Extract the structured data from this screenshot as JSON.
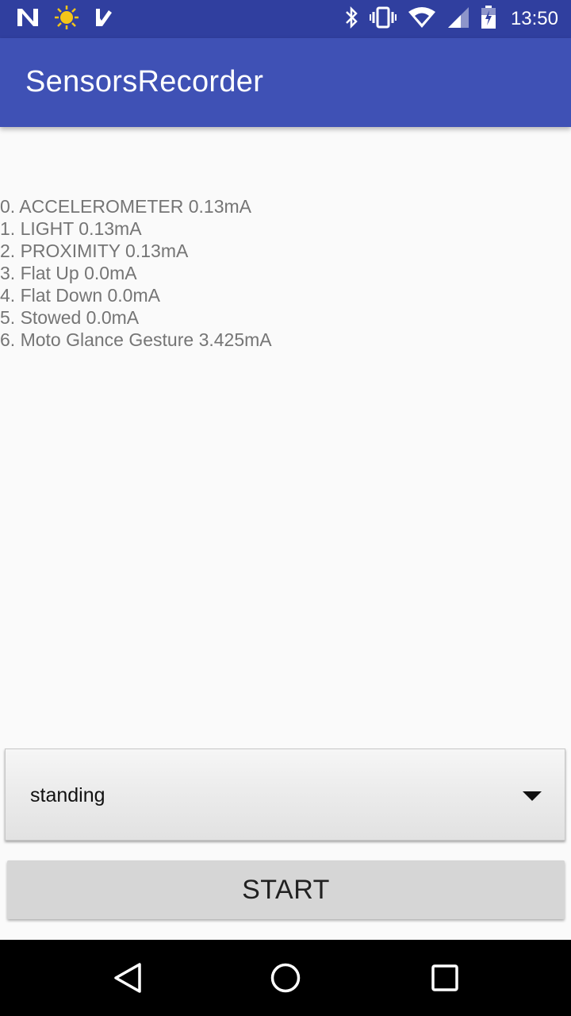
{
  "status_bar": {
    "left_icons": [
      "n-logo-icon",
      "sun-icon",
      "checkmark-app-icon"
    ],
    "right_icons": [
      "bluetooth-icon",
      "vibrate-icon",
      "wifi-icon",
      "signal-icon",
      "battery-icon"
    ],
    "time": "13:50"
  },
  "app_bar": {
    "title": "SensorsRecorder",
    "color": "#3f51b5",
    "status_color": "#303f9f"
  },
  "sensors": [
    "0. ACCELEROMETER 0.13mA",
    "1. LIGHT 0.13mA",
    "2. PROXIMITY 0.13mA",
    "3. Flat Up 0.0mA",
    "4. Flat Down 0.0mA",
    "5. Stowed 0.0mA",
    "6. Moto Glance Gesture 3.425mA"
  ],
  "activity_spinner": {
    "selected": "standing",
    "icon": "dropdown-arrow-icon"
  },
  "start_button": {
    "label": "START"
  },
  "nav_bar": {
    "icons": [
      "back-icon",
      "home-icon",
      "recents-icon"
    ]
  }
}
